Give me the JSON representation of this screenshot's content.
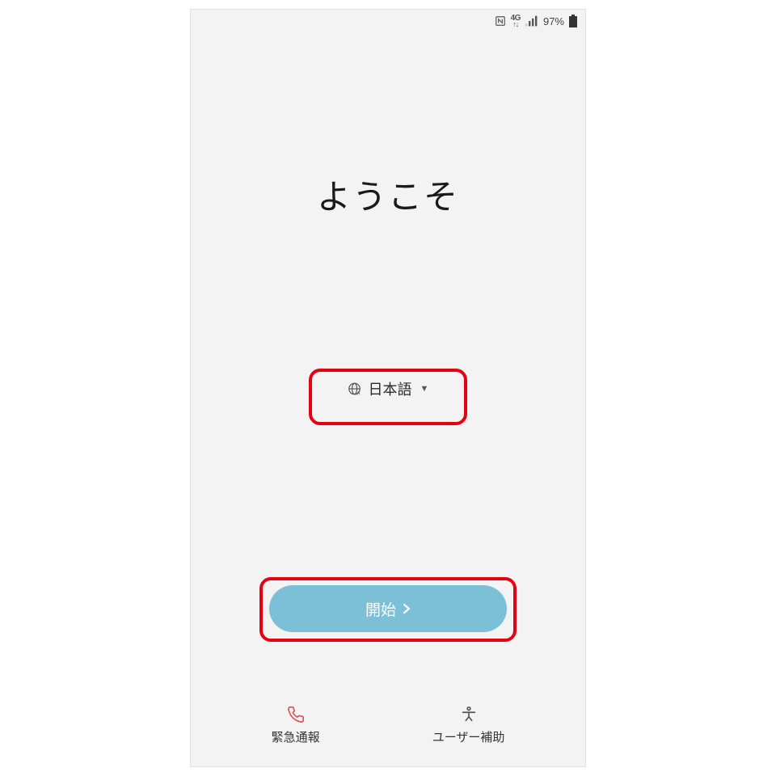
{
  "status_bar": {
    "network": "4G",
    "battery": "97%"
  },
  "welcome": {
    "title": "ようこそ"
  },
  "language": {
    "selected": "日本語"
  },
  "start": {
    "label": "開始"
  },
  "bottom": {
    "emergency_label": "緊急通報",
    "accessibility_label": "ユーザー補助"
  },
  "colors": {
    "highlight": "#e60012",
    "primary_button": "#7cc0d8"
  }
}
